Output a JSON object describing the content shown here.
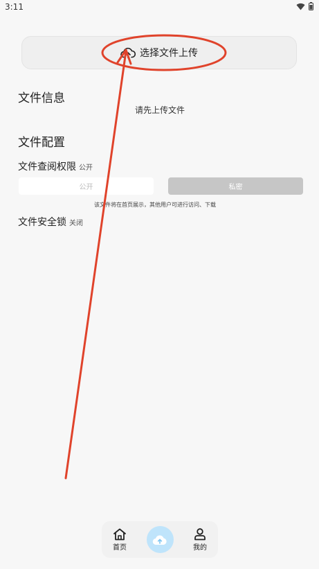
{
  "status": {
    "time": "3:11"
  },
  "upload": {
    "label": "选择文件上传"
  },
  "file_info": {
    "title": "文件信息",
    "placeholder": "请先上传文件"
  },
  "file_config": {
    "title": "文件配置",
    "permission_label": "文件查阅权限",
    "permission_value": "公开",
    "option_public": "公开",
    "option_private": "私密",
    "hint": "该文件将在首页展示，其他用户可进行访问、下载",
    "lock_label": "文件安全锁",
    "lock_value": "关闭"
  },
  "nav": {
    "home": "首页",
    "mine": "我的"
  },
  "colors": {
    "annotation": "#e0432b",
    "nav_center": "#bfe4fb"
  }
}
